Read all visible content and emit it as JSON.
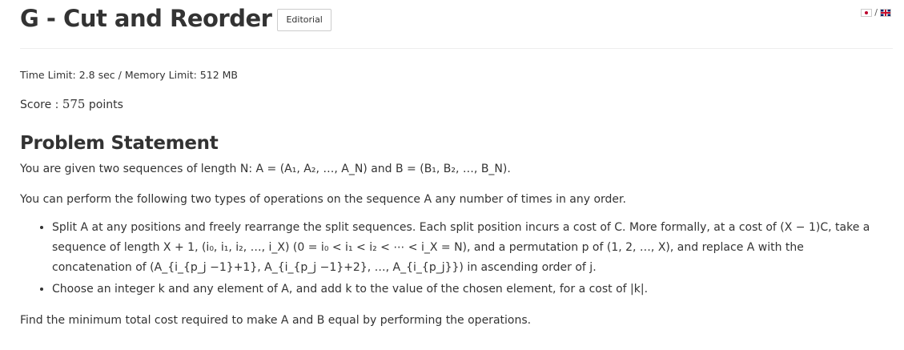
{
  "header": {
    "title": "G - Cut and Reorder",
    "editorial_label": "Editorial",
    "lang_separator": "/"
  },
  "limits_text": "Time Limit: 2.8 sec / Memory Limit: 512 MB",
  "score": {
    "label": "Score : ",
    "value": "575",
    "unit": " points"
  },
  "section_title": "Problem Statement",
  "statement": {
    "p1": "You are given two sequences of length N: A = (A₁, A₂, …, A_N) and B = (B₁, B₂, …, B_N).",
    "p2": "You can perform the following two types of operations on the sequence A any number of times in any order.",
    "bullet1": "Split A at any positions and freely rearrange the split sequences. Each split position incurs a cost of C. More formally, at a cost of (X − 1)C, take a sequence of length X + 1, (i₀, i₁, i₂, …, i_X) (0 = i₀ < i₁ < i₂ < ⋯ < i_X = N), and a permutation p of (1, 2, …, X), and replace A with the concatenation of (A_{i_{p_j −1}+1}, A_{i_{p_j −1}+2}, …, A_{i_{p_j}}) in ascending order of j.",
    "bullet2": "Choose an integer k and any element of A, and add k to the value of the chosen element, for a cost of |k|.",
    "p3": "Find the minimum total cost required to make A and B equal by performing the operations."
  }
}
